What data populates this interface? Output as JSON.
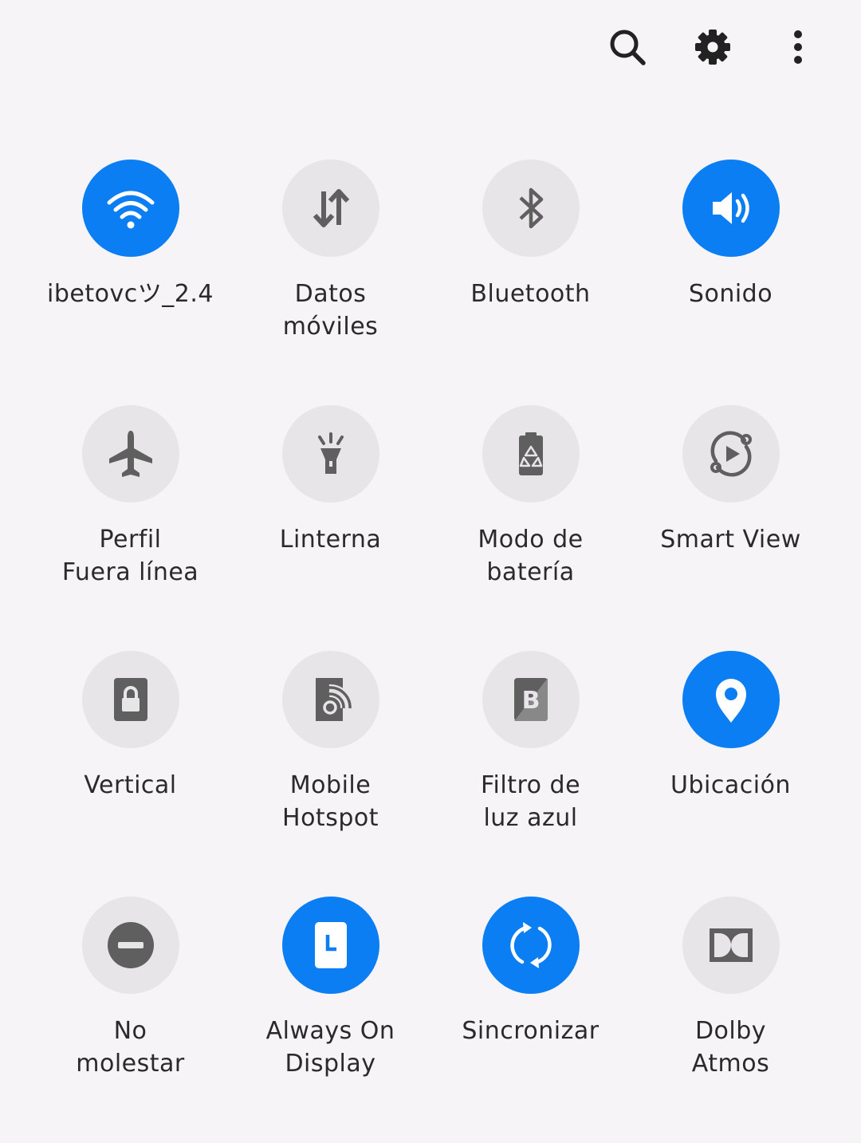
{
  "header": {
    "icons": [
      "search-icon",
      "gear-icon",
      "more-vertical-icon"
    ]
  },
  "colors": {
    "background": "#f6f4f6",
    "tile_off": "#e7e5e7",
    "tile_on": "#0a7ef2",
    "icon_off": "#5f5f5f",
    "icon_on": "#ffffff",
    "label": "#2a2a2a"
  },
  "tiles": [
    {
      "label": "ibetovcツ_2.4",
      "icon": "wifi-icon",
      "active": true
    },
    {
      "label": "Datos\nmóviles",
      "icon": "mobile-data-icon",
      "active": false
    },
    {
      "label": "Bluetooth",
      "icon": "bluetooth-icon",
      "active": false
    },
    {
      "label": "Sonido",
      "icon": "sound-icon",
      "active": true
    },
    {
      "label": "Perfil\nFuera línea",
      "icon": "airplane-icon",
      "active": false
    },
    {
      "label": "Linterna",
      "icon": "flashlight-icon",
      "active": false
    },
    {
      "label": "Modo de\nbatería",
      "icon": "battery-mode-icon",
      "active": false
    },
    {
      "label": "Smart View",
      "icon": "smart-view-icon",
      "active": false
    },
    {
      "label": "Vertical",
      "icon": "rotation-lock-icon",
      "active": false
    },
    {
      "label": "Mobile\nHotspot",
      "icon": "hotspot-icon",
      "active": false
    },
    {
      "label": "Filtro de\nluz azul",
      "icon": "blue-light-filter-icon",
      "active": false
    },
    {
      "label": "Ubicación",
      "icon": "location-icon",
      "active": true
    },
    {
      "label": "No\nmolestar",
      "icon": "do-not-disturb-icon",
      "active": false
    },
    {
      "label": "Always On\nDisplay",
      "icon": "always-on-display-icon",
      "active": true
    },
    {
      "label": "Sincronizar",
      "icon": "sync-icon",
      "active": true
    },
    {
      "label": "Dolby\nAtmos",
      "icon": "dolby-icon",
      "active": false
    }
  ]
}
